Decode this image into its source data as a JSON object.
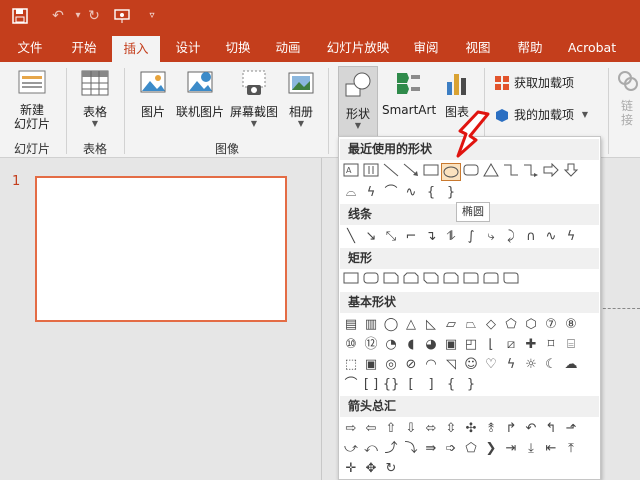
{
  "tabs": [
    "文件",
    "开始",
    "插入",
    "设计",
    "切换",
    "动画",
    "幻灯片放映",
    "审阅",
    "视图",
    "帮助",
    "Acrobat"
  ],
  "ribbon": {
    "new_slide": "新建\n幻灯片",
    "group_slides": "幻灯片",
    "table": "表格",
    "group_tables": "表格",
    "picture": "图片",
    "online_picture": "联机图片",
    "screenshot": "屏幕截图",
    "album": "相册",
    "group_images": "图像",
    "shapes": "形状",
    "smartart": "SmartArt",
    "chart": "图表",
    "get_addins": "获取加载项",
    "my_addins": "我的加载项",
    "link": "链\n接"
  },
  "gallery": {
    "sections": [
      "最近使用的形状",
      "线条",
      "矩形",
      "基本形状",
      "箭头总汇"
    ],
    "tooltip": "椭圆"
  },
  "slide_number": "1",
  "colors": {
    "accent": "#c43e1c",
    "thumb_border": "#e46c45"
  }
}
